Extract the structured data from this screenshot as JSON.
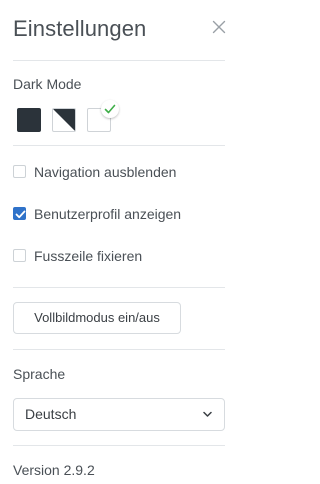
{
  "panel": {
    "title": "Einstellungen",
    "close_icon": "close-icon"
  },
  "dark_mode": {
    "label": "Dark Mode",
    "options": [
      {
        "name": "dark",
        "color": "#2b333a",
        "selected": false
      },
      {
        "name": "split",
        "color": "#2b333a",
        "selected": false
      },
      {
        "name": "light",
        "color": "#ffffff",
        "selected": true
      }
    ],
    "check_color": "#3fae49"
  },
  "options": [
    {
      "label": "Navigation ausblenden",
      "checked": false
    },
    {
      "label": "Benutzerprofil anzeigen",
      "checked": true
    },
    {
      "label": "Fusszeile fixieren",
      "checked": false
    }
  ],
  "fullscreen_button": {
    "label": "Vollbildmodus ein/aus"
  },
  "language": {
    "label": "Sprache",
    "selected": "Deutsch"
  },
  "version": "Version 2.9.2",
  "colors": {
    "accent": "#2f72c9",
    "divider": "#e3e6e9",
    "text": "#4a5056"
  }
}
